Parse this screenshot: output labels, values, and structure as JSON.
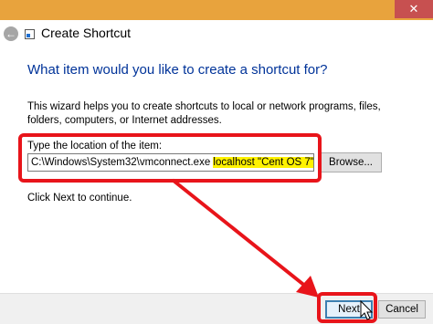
{
  "window": {
    "title": "Create Shortcut",
    "close_glyph": "✕",
    "back_glyph": "←"
  },
  "heading": "What item would you like to create a shortcut for?",
  "description": "This wizard helps you to create shortcuts to local or network programs, files, folders, computers, or Internet addresses.",
  "location": {
    "label": "Type the location of the item:",
    "value_plain": "C:\\Windows\\System32\\vmconnect.exe ",
    "value_highlighted": "localhost \"Cent OS 7\"",
    "browse_label": "Browse..."
  },
  "hint": "Click Next to continue.",
  "buttons": {
    "next_label": "Next",
    "cancel_label": "Cancel"
  },
  "colors": {
    "titlebar": "#e8a33d",
    "heading": "#003399",
    "annotation": "#e8141a",
    "highlight": "#fff200"
  }
}
